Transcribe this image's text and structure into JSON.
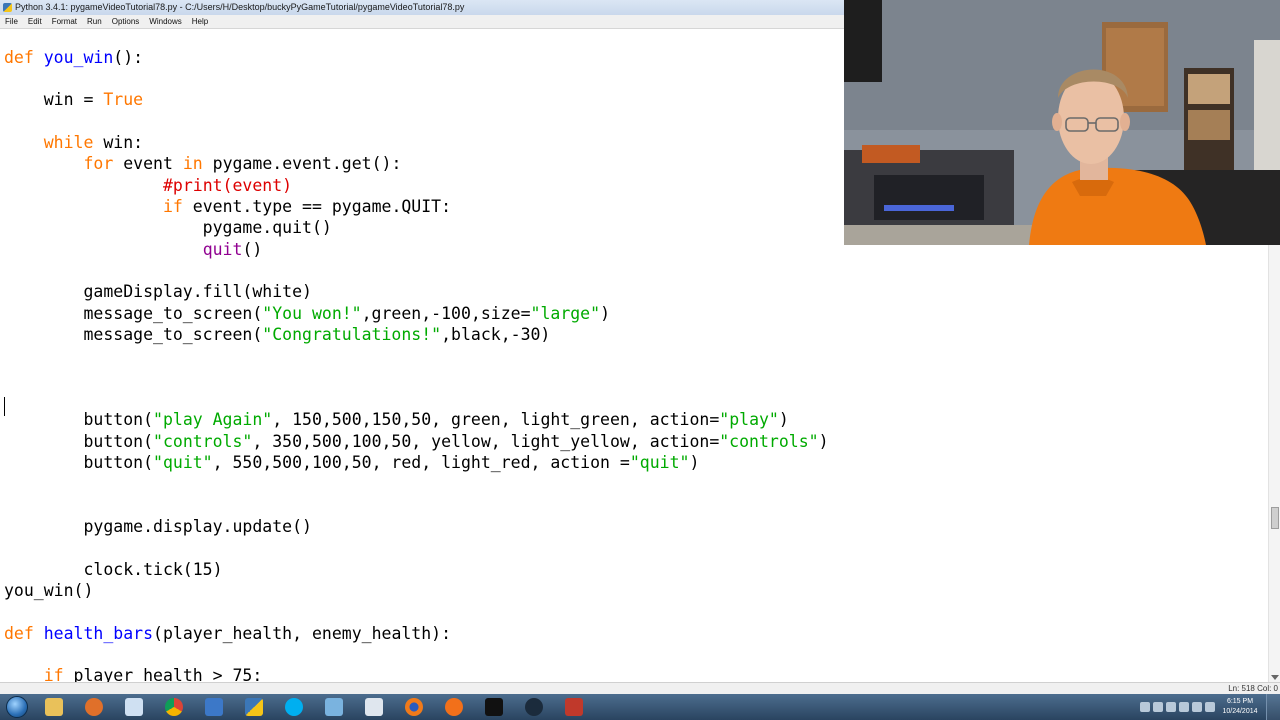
{
  "window": {
    "title": "Python 3.4.1: pygameVideoTutorial78.py - C:/Users/H/Desktop/buckyPyGameTutorial/pygameVideoTutorial78.py"
  },
  "menu": [
    "File",
    "Edit",
    "Format",
    "Run",
    "Options",
    "Windows",
    "Help"
  ],
  "colors": {
    "keyword": "#ff7700",
    "definition": "#0000ff",
    "string": "#00aa00",
    "comment": "#dd0000",
    "builtin": "#900090"
  },
  "code": {
    "l1": [
      "def",
      " ",
      "you_win",
      "():"
    ],
    "l2": [
      "    win = ",
      "True"
    ],
    "l3": [
      "    ",
      "while",
      " win:"
    ],
    "l4": [
      "        ",
      "for",
      " event ",
      "in",
      " pygame.event.get():"
    ],
    "l5": [
      "                ",
      "#print(event)"
    ],
    "l6": [
      "                ",
      "if",
      " event.type == pygame.QUIT:"
    ],
    "l7": [
      "                    pygame.quit()"
    ],
    "l8": [
      "                    ",
      "quit",
      "()"
    ],
    "l9": [
      "        gameDisplay.fill(white)"
    ],
    "l10": [
      "        message_to_screen(",
      "\"You won!\"",
      ",green,-100,size=",
      "\"large\"",
      ")"
    ],
    "l11": [
      "        message_to_screen(",
      "\"Congratulations!\"",
      ",black,-30)"
    ],
    "l12": [
      "        button(",
      "\"play Again\"",
      ", 150,500,150,50, green, light_green, action=",
      "\"play\"",
      ")"
    ],
    "l13": [
      "        button(",
      "\"controls\"",
      ", 350,500,100,50, yellow, light_yellow, action=",
      "\"controls\"",
      ")"
    ],
    "l14": [
      "        button(",
      "\"quit\"",
      ", 550,500,100,50, red, light_red, action =",
      "\"quit\"",
      ")"
    ],
    "l15": [
      "        pygame.display.update()"
    ],
    "l16": [
      "        clock.tick(15)"
    ],
    "l17": [
      "you_win()"
    ],
    "l18": [
      "def",
      " ",
      "health_bars",
      "(player_health, enemy_health):"
    ],
    "l19": [
      "    ",
      "if",
      " player_health > 75:"
    ]
  },
  "status": {
    "position": "Ln: 518  Col: 0"
  },
  "taskbar": {
    "apps": [
      "file-explorer",
      "media-player",
      "notepad",
      "chrome",
      "app-feather",
      "python-idle",
      "skype",
      "app-blue",
      "remote-desktop",
      "firefox",
      "app-orange",
      "command-prompt",
      "camera-app",
      "app-red"
    ],
    "clock_time": "6:15 PM",
    "clock_date": "10/24/2014"
  },
  "webcam": {
    "label": "webcam-feed"
  }
}
